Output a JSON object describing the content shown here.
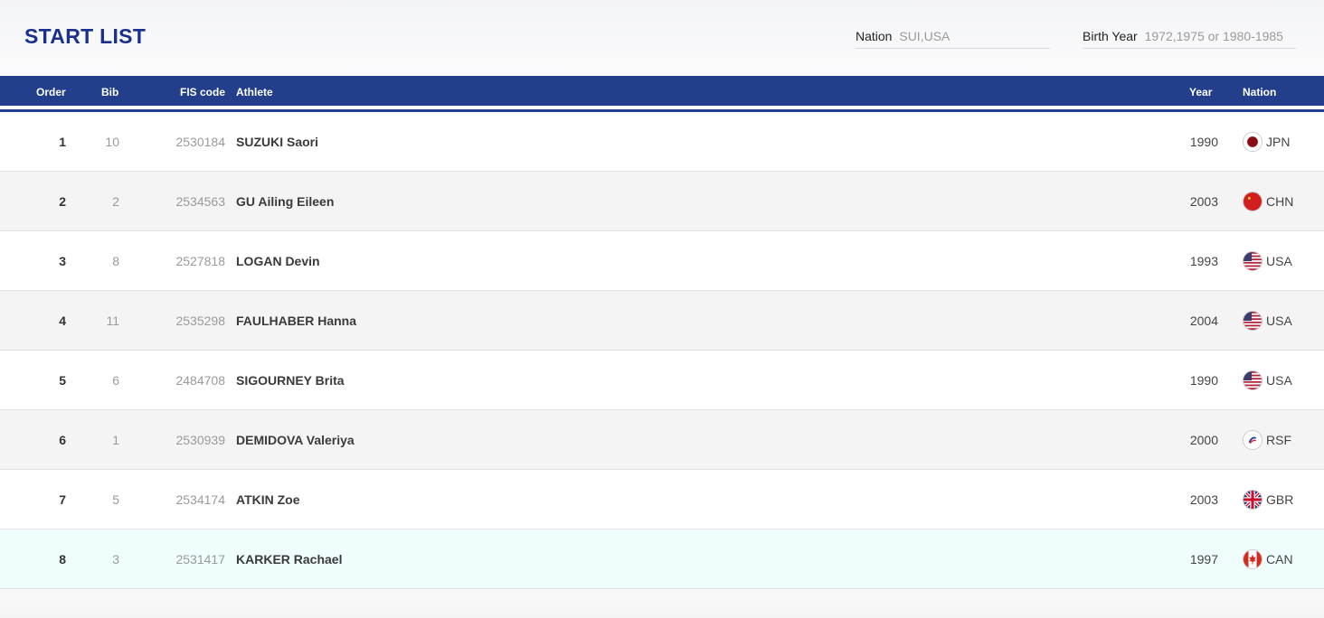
{
  "header": {
    "title": "START LIST",
    "filters": {
      "nation": {
        "label": "Nation",
        "value": "SUI,USA"
      },
      "birth_year": {
        "label": "Birth Year",
        "value": "1972,1975 or 1980-1985"
      }
    }
  },
  "table": {
    "columns": {
      "order": "Order",
      "bib": "Bib",
      "fis_code": "FIS code",
      "athlete": "Athlete",
      "year": "Year",
      "nation": "Nation"
    },
    "rows": [
      {
        "order": "1",
        "bib": "10",
        "fis_code": "2530184",
        "athlete": "SUZUKI Saori",
        "year": "1990",
        "nation": "JPN",
        "flag_icon": "jpn-flag-icon"
      },
      {
        "order": "2",
        "bib": "2",
        "fis_code": "2534563",
        "athlete": "GU Ailing Eileen",
        "year": "2003",
        "nation": "CHN",
        "flag_icon": "chn-flag-icon"
      },
      {
        "order": "3",
        "bib": "8",
        "fis_code": "2527818",
        "athlete": "LOGAN Devin",
        "year": "1993",
        "nation": "USA",
        "flag_icon": "usa-flag-icon"
      },
      {
        "order": "4",
        "bib": "11",
        "fis_code": "2535298",
        "athlete": "FAULHABER Hanna",
        "year": "2004",
        "nation": "USA",
        "flag_icon": "usa-flag-icon"
      },
      {
        "order": "5",
        "bib": "6",
        "fis_code": "2484708",
        "athlete": "SIGOURNEY Brita",
        "year": "1990",
        "nation": "USA",
        "flag_icon": "usa-flag-icon"
      },
      {
        "order": "6",
        "bib": "1",
        "fis_code": "2530939",
        "athlete": "DEMIDOVA Valeriya",
        "year": "2000",
        "nation": "RSF",
        "flag_icon": "rsf-flag-icon"
      },
      {
        "order": "7",
        "bib": "5",
        "fis_code": "2534174",
        "athlete": "ATKIN Zoe",
        "year": "2003",
        "nation": "GBR",
        "flag_icon": "gbr-flag-icon"
      },
      {
        "order": "8",
        "bib": "3",
        "fis_code": "2531417",
        "athlete": "KARKER Rachael",
        "year": "1997",
        "nation": "CAN",
        "flag_icon": "can-flag-icon"
      }
    ]
  },
  "colors": {
    "title": "#1b2f8c",
    "header_bar": "#233f8c",
    "row_even": "#f4f4f4",
    "row_highlight": "#effdfd"
  }
}
